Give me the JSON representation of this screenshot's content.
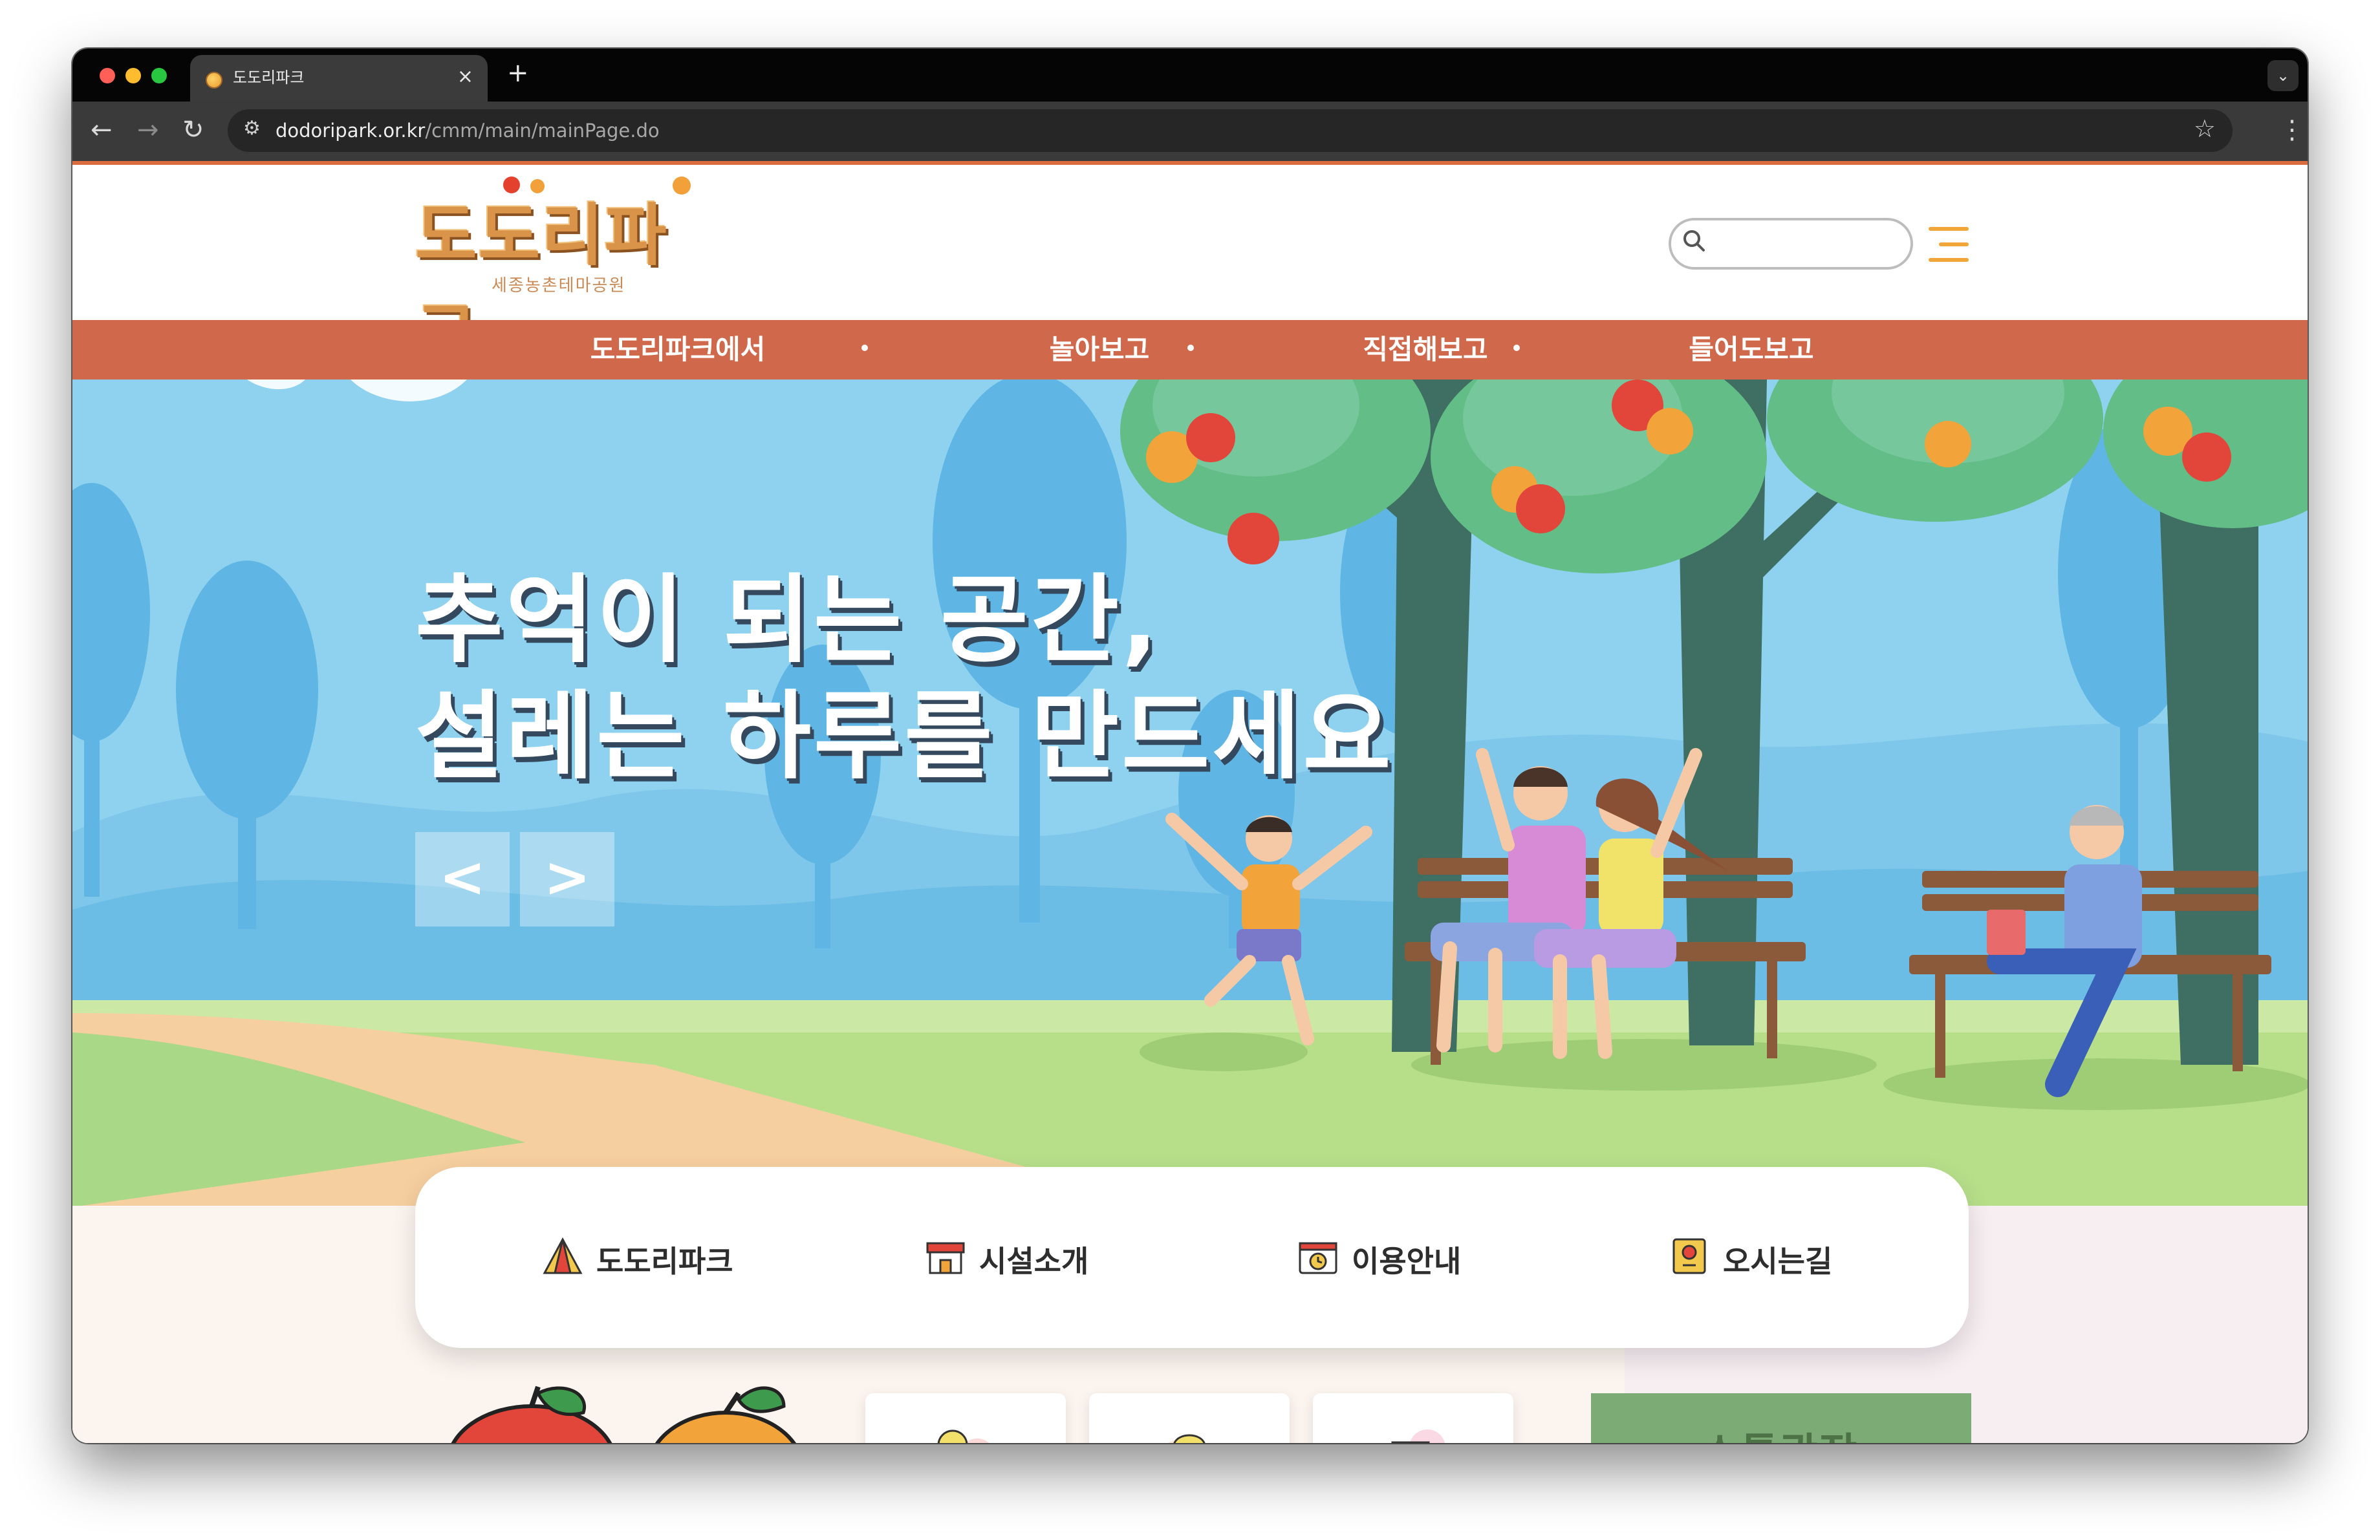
{
  "browser": {
    "tab_title": "도도리파크",
    "tab_close": "×",
    "new_tab": "+",
    "tab_menu": "⌄",
    "url_host": "dodoripark.or.kr",
    "url_path": "/cmm/main/mainPage.do",
    "nav_back": "←",
    "nav_forward": "→",
    "nav_reload": "↻",
    "menu_kebab": "⋮",
    "bookmark_star": "☆",
    "site_info": "⚙"
  },
  "site": {
    "logo_title": "도도리파크",
    "logo_subtitle": "세종농촌테마공원",
    "search": {
      "placeholder": ""
    },
    "nav": [
      "도도리파크에서",
      "놀아보고",
      "직접해보고",
      "들어도보고"
    ],
    "hero": {
      "line1": "추억이 되는 공간,",
      "line2": "설레는 하루를 만드세요",
      "prev": "<",
      "next": ">"
    },
    "quick_menu": [
      {
        "label": "도도리파크",
        "icon": "tent-icon"
      },
      {
        "label": "시설소개",
        "icon": "shop-icon"
      },
      {
        "label": "이용안내",
        "icon": "calendar-clock-icon"
      },
      {
        "label": "오시는길",
        "icon": "map-pin-icon"
      }
    ],
    "programs": [
      {
        "icon": "apple-pick-icon"
      },
      {
        "icon": "bbq-grill-icon"
      },
      {
        "icon": "tea-cup-icon"
      }
    ],
    "board_title": "소통광장"
  },
  "colors": {
    "nav_bg": "#d0694b",
    "accent_orange": "#f0a638",
    "sky": "#8ed2ef",
    "board_green": "#7dab76"
  }
}
